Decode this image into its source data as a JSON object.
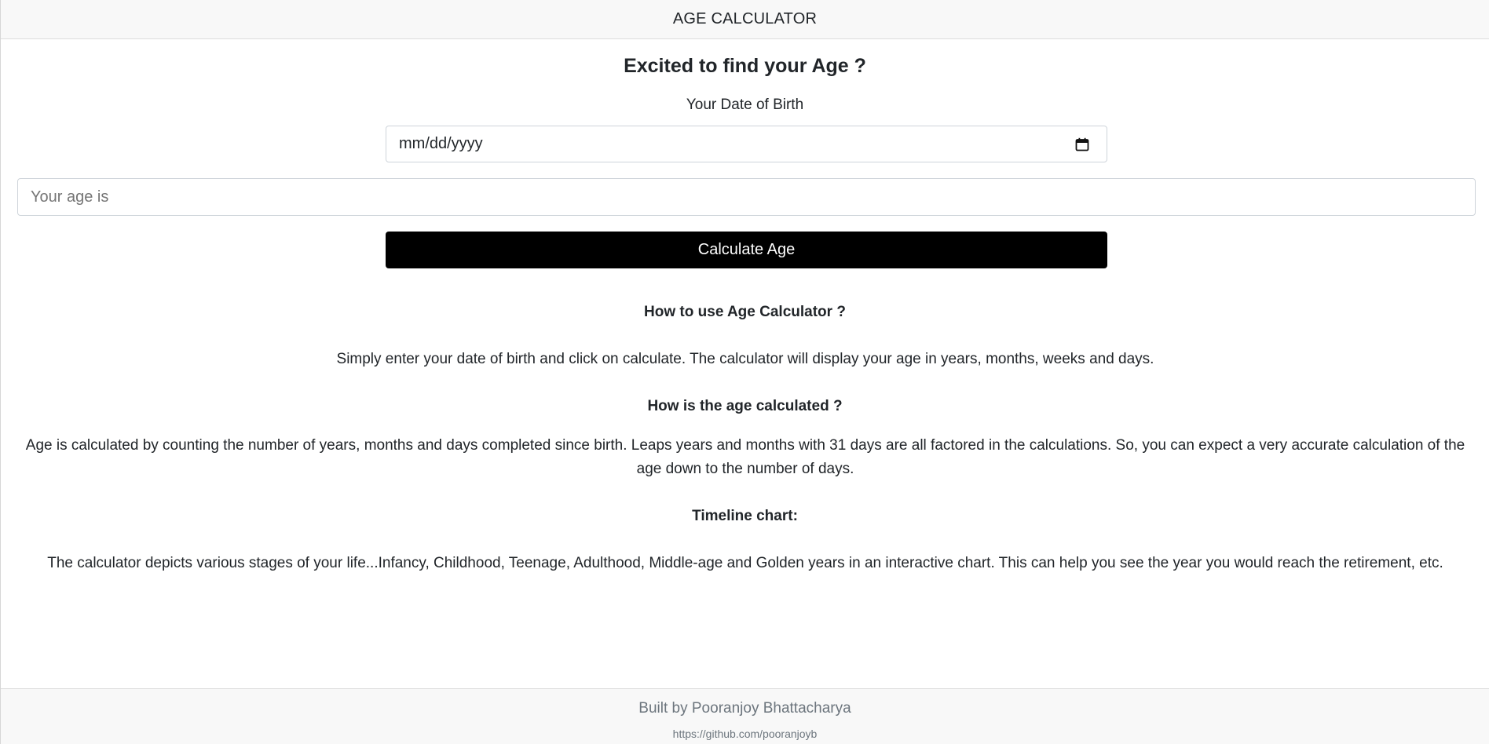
{
  "navbar": {
    "title": "AGE CALCULATOR"
  },
  "main": {
    "heading": "Excited to find your Age ?",
    "dob_label": "Your Date of Birth",
    "dob_input": {
      "placeholder": "mm/dd/yyyy",
      "icon": "calendar-icon"
    },
    "age_output": {
      "placeholder": "Your age is"
    },
    "calculate_button": "Calculate Age"
  },
  "sections": [
    {
      "title": "How to use Age Calculator ?",
      "text": "Simply enter your date of birth and click on calculate. The calculator will display your age in years, months, weeks and days."
    },
    {
      "title": "How is the age calculated ?",
      "text": "Age is calculated by counting the number of years, months and days completed since birth. Leaps years and months with 31 days are all factored in the calculations. So, you can expect a very accurate calculation of the age down to the number of days."
    },
    {
      "title": "Timeline chart:",
      "text": "The calculator depicts various stages of your life...Infancy, Childhood, Teenage, Adulthood, Middle-age and Golden years in an interactive chart. This can help you see the year you would reach the retirement, etc."
    }
  ],
  "footer": {
    "credit": "Built by Pooranjoy Bhattacharya",
    "link": "https://github.com/pooranjoyb"
  },
  "colors": {
    "button_bg": "#000000",
    "button_text": "#ffffff",
    "navbar_bg": "#f8f8f8",
    "muted_text": "#6c757d"
  }
}
